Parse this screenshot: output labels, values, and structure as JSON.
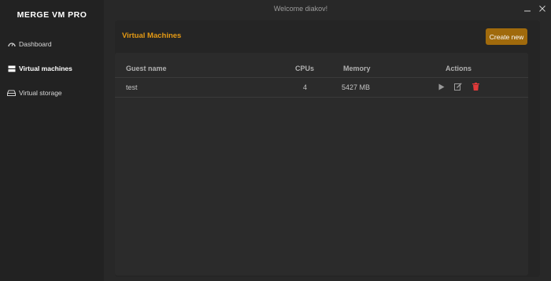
{
  "app": {
    "brand": "MERGE VM PRO",
    "welcome": "Welcome diakov!"
  },
  "window_controls": {
    "minimize_icon": "minimize-icon",
    "close_icon": "close-icon"
  },
  "sidebar": {
    "items": [
      {
        "label": "Dashboard",
        "icon": "dashboard-gauge-icon",
        "active": false
      },
      {
        "label": "Virtual machines",
        "icon": "server-icon",
        "active": true
      },
      {
        "label": "Virtual storage",
        "icon": "hard-drive-icon",
        "active": false
      }
    ]
  },
  "main": {
    "title": "Virtual Machines",
    "create_button": "Create new",
    "table": {
      "headers": {
        "guest": "Guest name",
        "cpus": "CPUs",
        "memory": "Memory",
        "actions": "Actions"
      },
      "rows": [
        {
          "guest": "test",
          "cpus": "4",
          "memory": "5427 MB",
          "actions": [
            "play-icon",
            "edit-icon",
            "trash-icon"
          ]
        }
      ]
    }
  },
  "colors": {
    "accent": "#e59a14",
    "button": "#a06a0c",
    "danger": "#e23a3a",
    "background": "#282828"
  }
}
